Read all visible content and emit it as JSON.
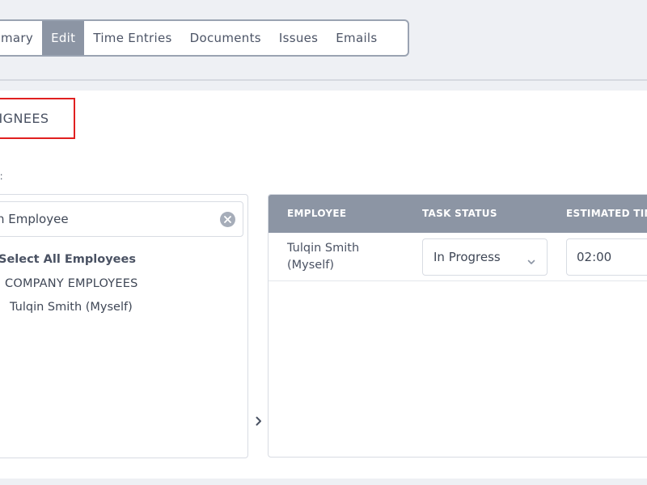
{
  "tabs": [
    {
      "label": "mary"
    },
    {
      "label": "Edit"
    },
    {
      "label": "Time Entries"
    },
    {
      "label": "Documents"
    },
    {
      "label": "Issues"
    },
    {
      "label": "Emails"
    }
  ],
  "section": {
    "title": "SIGNEES"
  },
  "field": {
    "label": "S:"
  },
  "search": {
    "value": "h Employee"
  },
  "tree": {
    "select_all": "Select All Employees",
    "group": "COMPANY EMPLOYEES",
    "user": "Tulqin Smith (Myself)"
  },
  "table": {
    "headers": {
      "employee": "EMPLOYEE",
      "status": "TASK STATUS",
      "time": "ESTIMATED TIM"
    },
    "rows": [
      {
        "employee_line1": "Tulqin Smith",
        "employee_line2": "(Myself)",
        "status": "In Progress",
        "time": "02:00"
      }
    ]
  },
  "colors": {
    "accent": "#8c95a4",
    "highlight_border": "#e02020"
  }
}
